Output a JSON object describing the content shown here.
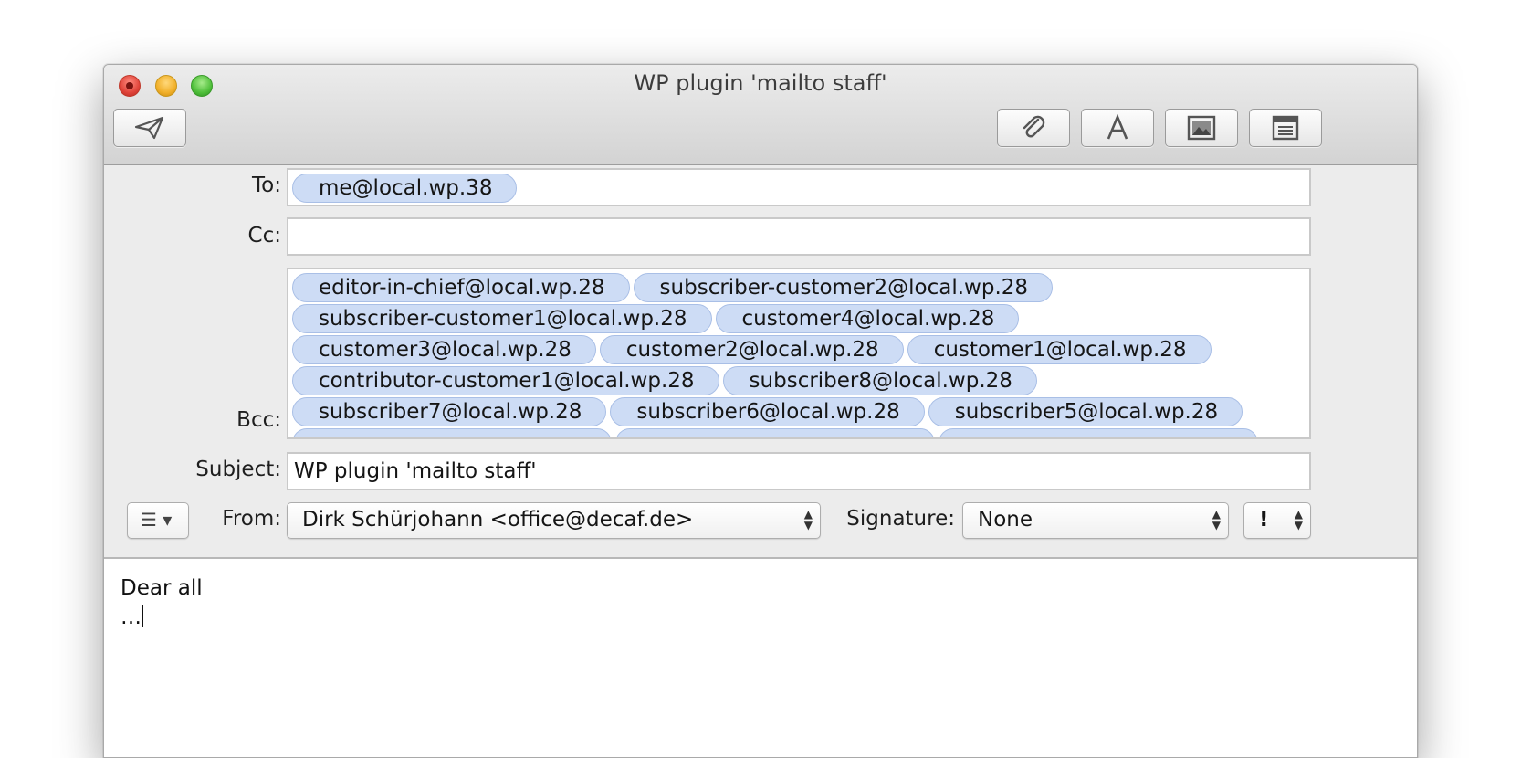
{
  "window": {
    "title": "WP plugin 'mailto staff'"
  },
  "toolbar": {
    "send": "paper-plane-icon",
    "attach": "paperclip-icon",
    "format": "font-icon",
    "photo": "photo-browser-icon",
    "stationery": "stationery-icon"
  },
  "header": {
    "to_label": "To:",
    "to_recipients": [
      "me@local.wp.38"
    ],
    "cc_label": "Cc:",
    "bcc_label": "Bcc:",
    "bcc_recipients": [
      [
        "editor-in-chief@local.wp.28",
        "subscriber-customer2@local.wp.28"
      ],
      [
        "subscriber-customer1@local.wp.28",
        "customer4@local.wp.28"
      ],
      [
        "customer3@local.wp.28",
        "customer2@local.wp.28",
        "customer1@local.wp.28"
      ],
      [
        "contributor-customer1@local.wp.28",
        "subscriber8@local.wp.28"
      ],
      [
        "subscriber7@local.wp.28",
        "subscriber6@local.wp.28",
        "subscriber5@local.wp.28"
      ]
    ],
    "subject_label": "Subject:",
    "subject_value": "WP plugin 'mailto staff'",
    "from_label": "From:",
    "from_value": "Dirk Schürjohann <office@decaf.de>",
    "signature_label": "Signature:",
    "signature_value": "None",
    "priority_value": "!"
  },
  "body": {
    "line1": "Dear all",
    "line2": "…"
  }
}
